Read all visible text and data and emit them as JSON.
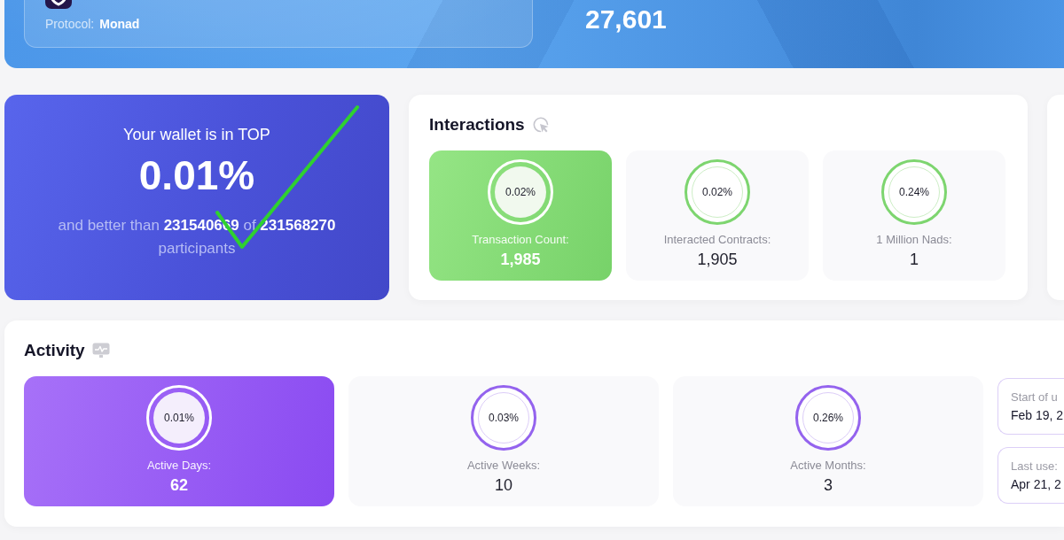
{
  "banner": {
    "protocol_label": "Protocol:",
    "protocol": "Monad",
    "score": "27,601"
  },
  "rank": {
    "title": "Your wallet is in TOP",
    "percent": "0.01%",
    "summary": "and better than **231540669** of **231568270** participants"
  },
  "interactions": {
    "title": "Interactions",
    "items": [
      {
        "percent": "0.02%",
        "label": "Transaction Count:",
        "value": "1,985",
        "highlighted": true
      },
      {
        "percent": "0.02%",
        "label": "Interacted Contracts:",
        "value": "1,905",
        "highlighted": false
      },
      {
        "percent": "0.24%",
        "label": "1 Million Nads:",
        "value": "1",
        "highlighted": false
      }
    ]
  },
  "activity": {
    "title": "Activity",
    "items": [
      {
        "percent": "0.01%",
        "label": "Active Days:",
        "value": "62",
        "highlighted": true
      },
      {
        "percent": "0.03%",
        "label": "Active Weeks:",
        "value": "10",
        "highlighted": false
      },
      {
        "percent": "0.26%",
        "label": "Active Months:",
        "value": "3",
        "highlighted": false
      }
    ],
    "dates": [
      {
        "label": "Start of u",
        "value": "Feb 19, 2"
      },
      {
        "label": "Last use:",
        "value": "Apr 21, 2"
      }
    ]
  }
}
